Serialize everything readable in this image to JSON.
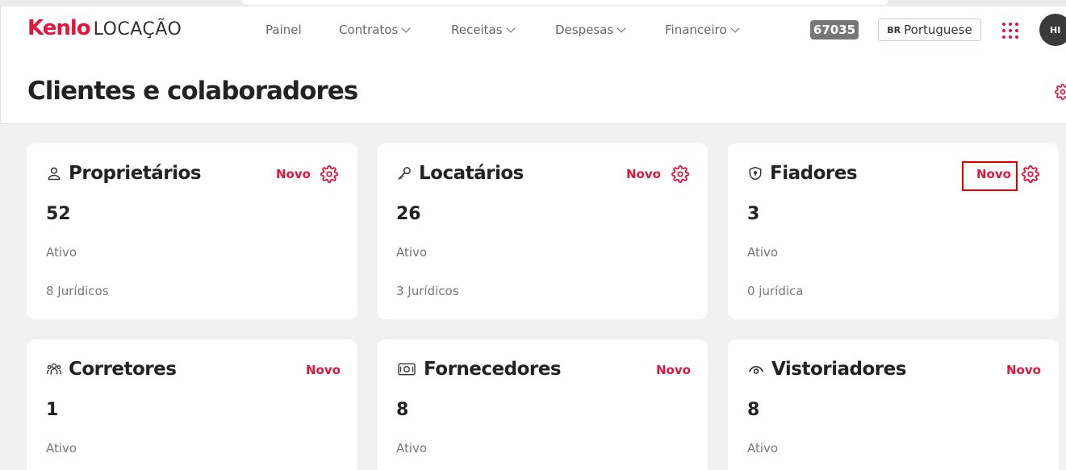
{
  "brand": {
    "name": "Kenlo",
    "product": "LOCAÇÃO"
  },
  "nav": {
    "items": [
      {
        "label": "Painel",
        "dropdown": false
      },
      {
        "label": "Contratos",
        "dropdown": true
      },
      {
        "label": "Receitas",
        "dropdown": true
      },
      {
        "label": "Despesas",
        "dropdown": true
      },
      {
        "label": "Financeiro",
        "dropdown": true
      }
    ]
  },
  "header": {
    "code_badge": "67035",
    "language": {
      "flag": "BR",
      "label": "Portuguese"
    },
    "apps_icon": "grid-dots-icon",
    "user_initials": "HI"
  },
  "page": {
    "title": "Clientes e colaboradores"
  },
  "colors": {
    "accent": "#e5143e",
    "badge": "#777777",
    "background": "#f1f1f1"
  },
  "cards": [
    {
      "title": "Proprietários",
      "icon": "user-icon",
      "new_label": "Novo",
      "count": "52",
      "status": "Ativo",
      "juridicos": "8 Jurídicos",
      "has_settings": true
    },
    {
      "title": "Locatários",
      "icon": "key-icon",
      "new_label": "Novo",
      "count": "26",
      "status": "Ativo",
      "juridicos": "3 Jurídicos",
      "has_settings": true
    },
    {
      "title": "Fiadores",
      "icon": "shield-icon",
      "new_label": "Novo",
      "count": "3",
      "status": "Ativo",
      "juridicos": "0 jurídica",
      "has_settings": true,
      "highlighted": true
    },
    {
      "title": "Corretores",
      "icon": "team-icon",
      "new_label": "Novo",
      "count": "1",
      "status": "Ativo"
    },
    {
      "title": "Fornecedores",
      "icon": "supplier-icon",
      "new_label": "Novo",
      "count": "8",
      "status": "Ativo"
    },
    {
      "title": "Vistoriadores",
      "icon": "eye-icon",
      "new_label": "Novo",
      "count": "8",
      "status": "Ativo"
    }
  ]
}
